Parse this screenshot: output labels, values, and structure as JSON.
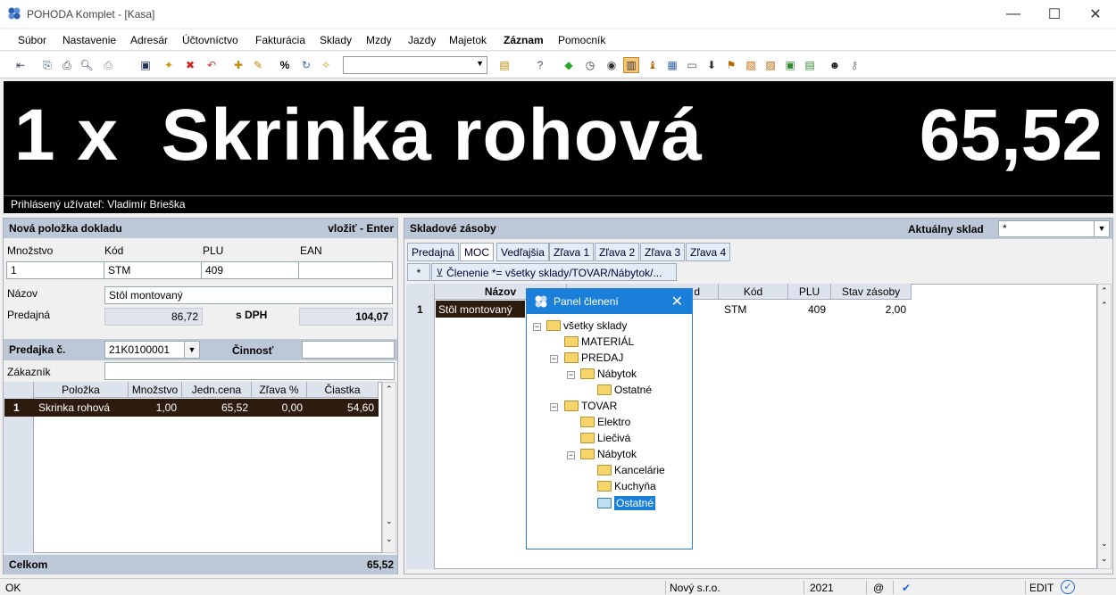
{
  "window": {
    "title": "POHODA Komplet - [Kasa]"
  },
  "menu": [
    "Súbor",
    "Nastavenie",
    "Adresár",
    "Účtovníctvo",
    "Fakturácia",
    "Sklady",
    "Mzdy",
    "Jazdy",
    "Majetok",
    "Záznam",
    "Pomocník"
  ],
  "display": {
    "line": "1 x  Skrinka rohová",
    "price": "65,52",
    "user": "Prihlásený užívateľ: Vladimír Brieška"
  },
  "new_item": {
    "header": "Nová položka dokladu",
    "shortcut": "vložiť - Enter",
    "labels": {
      "qty": "Množstvo",
      "code": "Kód",
      "plu": "PLU",
      "ean": "EAN",
      "name": "Názov",
      "price": "Predajná",
      "vat": "s DPH"
    },
    "values": {
      "qty": "1",
      "code": "STM",
      "plu": "409",
      "ean": "",
      "name": "Stôl montovaný",
      "price": "86,72",
      "price_vat": "104,07"
    }
  },
  "receipt": {
    "label": "Predajka č.",
    "number": "21K0100001",
    "activity_label": "Činnosť",
    "customer_label": "Zákazník",
    "columns": [
      "Položka",
      "Množstvo",
      "Jedn.cena",
      "Zľava %",
      "Čiastka"
    ],
    "rows": [
      {
        "n": "1",
        "item": "Skrinka rohová",
        "qty": "1,00",
        "unit": "65,52",
        "disc": "0,00",
        "amount": "54,60"
      }
    ],
    "total_label": "Celkom",
    "total": "65,52"
  },
  "stock": {
    "header": "Skladové zásoby",
    "current_label": "Aktuálny sklad",
    "current_value": "*",
    "tabs": [
      "Predajná",
      "MOC",
      "Vedľajšia",
      "Zľava 1",
      "Zľava 2",
      "Zľava 3",
      "Zľava 4"
    ],
    "filter": "Členenie *= všetky sklady/TOVAR/Nábytok/...",
    "filter_star": "*",
    "columns": [
      "Názov",
      "d",
      "Kód",
      "PLU",
      "Stav zásoby"
    ],
    "rows": [
      {
        "n": "1",
        "name": "Stôl montovaný",
        "code": "STM",
        "plu": "409",
        "stock": "2,00"
      }
    ]
  },
  "popup": {
    "title": "Panel členení",
    "tree": [
      "všetky sklady",
      "MATERIÁL",
      "PREDAJ",
      "Nábytok",
      "Ostatné",
      "TOVAR",
      "Elektro",
      "Liečivá",
      "Nábytok",
      "Kancelárie",
      "Kuchyňa",
      "Ostatné"
    ]
  },
  "status": {
    "left": "OK",
    "company": "Nový s.r.o.",
    "year": "2021",
    "at": "@",
    "mode": "EDIT"
  }
}
